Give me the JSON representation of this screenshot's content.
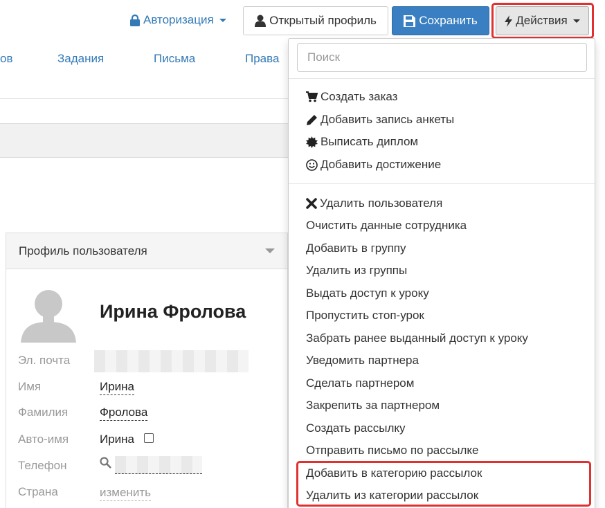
{
  "toolbar": {
    "auth_label": "Авторизация",
    "profile_label": "Открытый профиль",
    "save_label": "Сохранить",
    "actions_label": "Действия"
  },
  "tabs": [
    "ов",
    "Задания",
    "Письма",
    "Права"
  ],
  "profile": {
    "panel_title": "Профиль пользователя",
    "name": "Ирина Фролова",
    "labels": {
      "email": "Эл. почта",
      "first_name": "Имя",
      "last_name": "Фамилия",
      "auto_name": "Авто-имя",
      "phone": "Телефон",
      "country": "Страна"
    },
    "first_name": "Ирина",
    "last_name": "Фролова",
    "auto_name": "Ирина",
    "country_action": "изменить"
  },
  "dropdown": {
    "search_placeholder": "Поиск",
    "group1": [
      {
        "label": "Создать заказ",
        "icon": "cart-icon"
      },
      {
        "label": "Добавить запись анкеты",
        "icon": "pencil-icon"
      },
      {
        "label": "Выписать диплом",
        "icon": "certificate-icon"
      },
      {
        "label": "Добавить достижение",
        "icon": "smile-icon"
      }
    ],
    "group2": [
      {
        "label": "Удалить пользователя",
        "icon": "remove-icon"
      },
      {
        "label": "Очистить данные сотрудника"
      },
      {
        "label": "Добавить в группу"
      },
      {
        "label": "Удалить из группы"
      },
      {
        "label": "Выдать доступ к уроку"
      },
      {
        "label": "Пропустить стоп-урок"
      },
      {
        "label": "Забрать ранее выданный доступ к уроку"
      },
      {
        "label": "Уведомить партнера"
      },
      {
        "label": "Сделать партнером"
      },
      {
        "label": "Закрепить за партнером"
      },
      {
        "label": "Создать рассылку"
      },
      {
        "label": "Отправить письмо по рассылке"
      },
      {
        "label": "Добавить в категорию рассылок"
      },
      {
        "label": "Удалить из категории рассылок"
      }
    ]
  },
  "colors": {
    "link": "#337ab7",
    "primary": "#3a7fc1",
    "highlight": "#e0302f"
  }
}
